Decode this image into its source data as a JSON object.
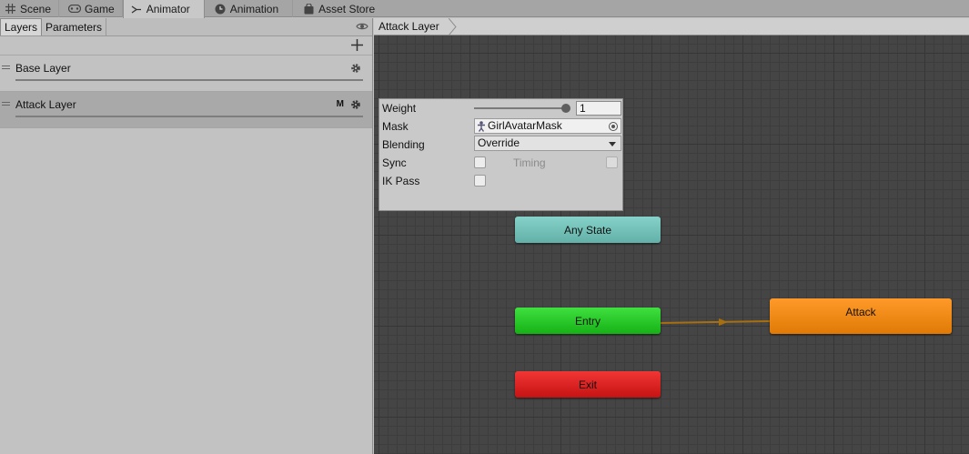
{
  "tabs": [
    {
      "label": "Scene",
      "icon": "grid-icon"
    },
    {
      "label": "Game",
      "icon": "gamepad-icon"
    },
    {
      "label": "Animator",
      "icon": "animator-icon",
      "active": true
    },
    {
      "label": "Animation",
      "icon": "clock-icon"
    },
    {
      "label": "Asset Store",
      "icon": "store-bag-icon"
    }
  ],
  "left": {
    "subtabs": [
      "Layers",
      "Parameters"
    ],
    "layers": [
      {
        "name": "Base Layer",
        "selected": false
      },
      {
        "name": "Attack Layer",
        "badge": "M",
        "selected": true
      }
    ]
  },
  "breadcrumb": "Attack Layer",
  "settings": {
    "weight_label": "Weight",
    "weight_value": "1",
    "mask_label": "Mask",
    "mask_value": "GirlAvatarMask",
    "blending_label": "Blending",
    "blending_value": "Override",
    "sync_label": "Sync",
    "timing_label": "Timing",
    "ikpass_label": "IK Pass"
  },
  "nodes": {
    "any_state": "Any State",
    "entry": "Entry",
    "exit": "Exit",
    "attack": "Attack"
  },
  "colors": {
    "any_state": "#6fbfb6",
    "entry": "#22c422",
    "exit": "#d81f1f",
    "attack": "#f08a12",
    "transition": "#a86f10"
  }
}
